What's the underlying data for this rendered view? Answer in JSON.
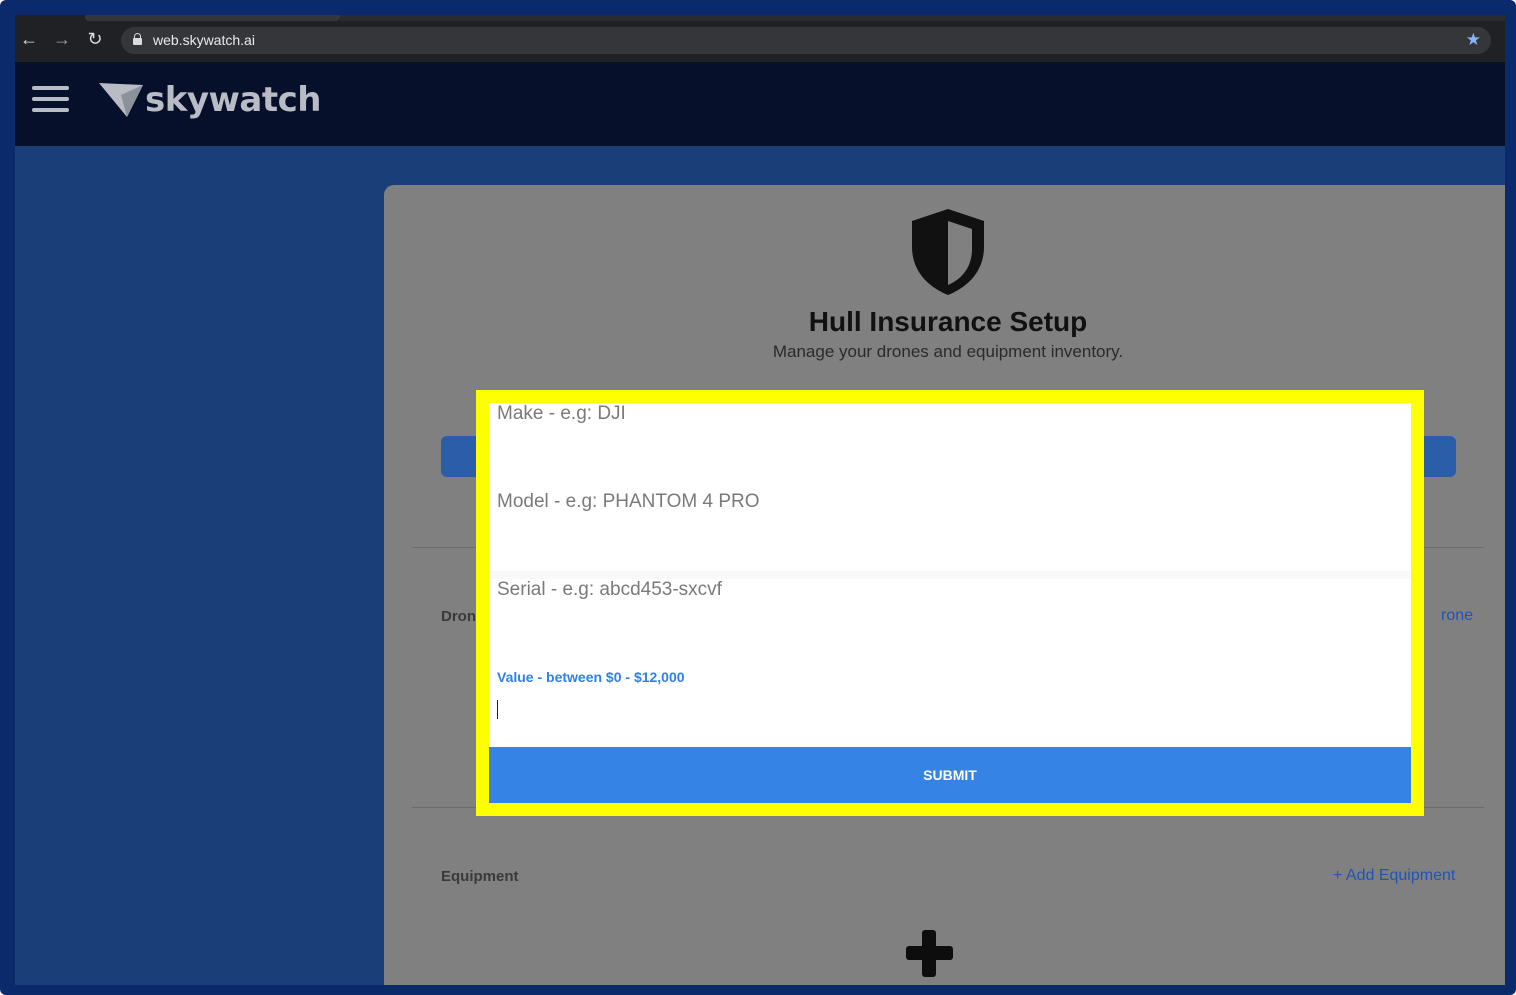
{
  "browser": {
    "url": "web.skywatch.ai",
    "back_icon": "←",
    "forward_icon": "→",
    "reload_icon": "↻",
    "star_icon": "★"
  },
  "header": {
    "brand": "skywatch",
    "background": "#06102b"
  },
  "page": {
    "title": "Hull Insurance Setup",
    "subtitle": "Manage your drones and equipment inventory.",
    "sections": {
      "drones_label_partial": "Dron",
      "add_drone_partial": "rone",
      "equipment_label": "Equipment",
      "add_equipment": "+ Add Equipment"
    }
  },
  "modal": {
    "border_color": "#ffff00",
    "make_placeholder": "Make - e.g: DJI",
    "model_placeholder": "Model - e.g: PHANTOM 4 PRO",
    "serial_placeholder": "Serial - e.g: abcd453-sxcvf",
    "value_label": "Value - between $0 - $12,000",
    "value_input": "",
    "submit_label": "SUBMIT",
    "submit_color": "#3583e4"
  }
}
